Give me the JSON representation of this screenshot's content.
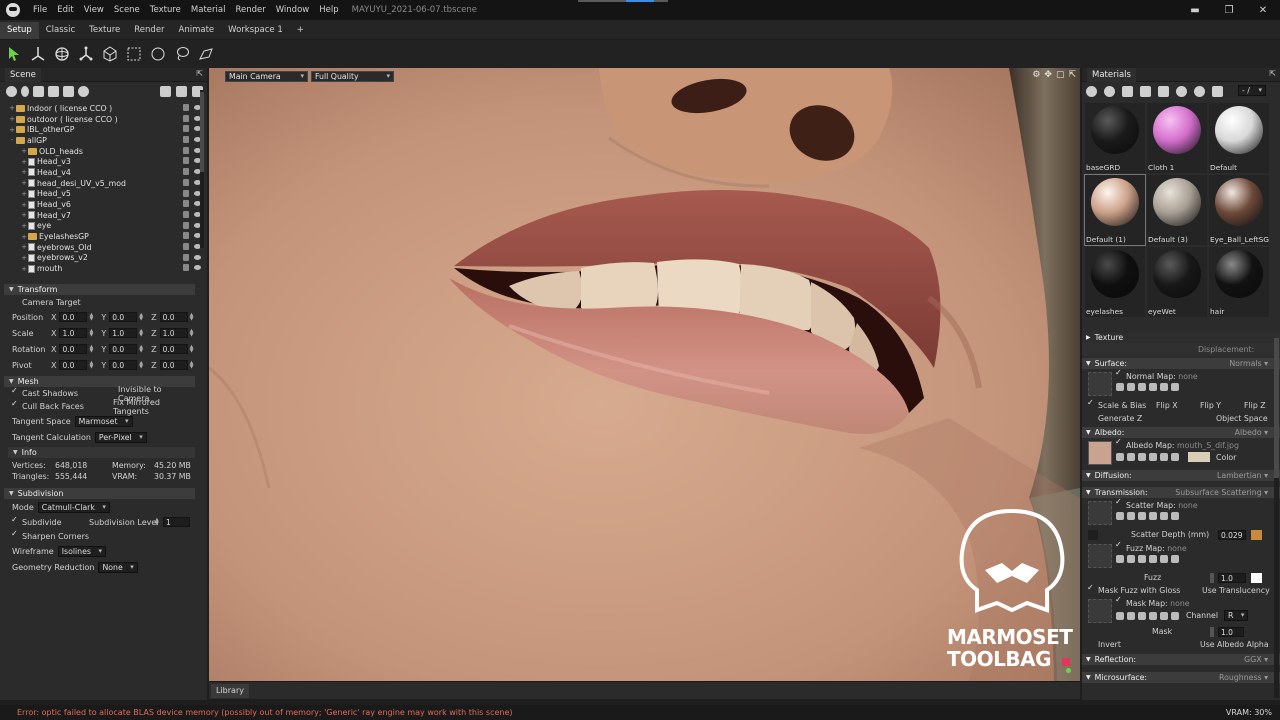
{
  "app": {
    "menu": [
      "File",
      "Edit",
      "View",
      "Scene",
      "Texture",
      "Material",
      "Render",
      "Window",
      "Help"
    ],
    "document_title": "MAYUYU_2021-06-07.tbscene"
  },
  "workspace_tabs": [
    "Setup",
    "Classic",
    "Texture",
    "Render",
    "Animate",
    "Workspace 1",
    "+"
  ],
  "scene": {
    "title": "Scene",
    "tree": [
      {
        "label": "Indoor ( license CCO )",
        "kind": "folder",
        "indent": 0,
        "expand": "+"
      },
      {
        "label": "outdoor ( license CCO )",
        "kind": "folder",
        "indent": 0,
        "expand": "+"
      },
      {
        "label": "IBL_otherGP",
        "kind": "folder",
        "indent": 0,
        "expand": "+"
      },
      {
        "label": "allGP",
        "kind": "folder",
        "indent": 0,
        "expand": "-"
      },
      {
        "label": "OLD_heads",
        "kind": "folder",
        "indent": 1,
        "expand": "+"
      },
      {
        "label": "Head_v3",
        "kind": "mesh",
        "indent": 1,
        "expand": "+"
      },
      {
        "label": "Head_v4",
        "kind": "mesh",
        "indent": 1,
        "expand": "+"
      },
      {
        "label": "head_desi_UV_v5_mod",
        "kind": "mesh",
        "indent": 1,
        "expand": "+"
      },
      {
        "label": "Head_v5",
        "kind": "mesh",
        "indent": 1,
        "expand": "+"
      },
      {
        "label": "Head_v6",
        "kind": "mesh",
        "indent": 1,
        "expand": "+"
      },
      {
        "label": "Head_v7",
        "kind": "mesh",
        "indent": 1,
        "expand": "+"
      },
      {
        "label": "eye",
        "kind": "mesh",
        "indent": 1,
        "expand": "+"
      },
      {
        "label": "EyelashesGP",
        "kind": "folder",
        "indent": 1,
        "expand": "+"
      },
      {
        "label": "eyebrows_Old",
        "kind": "mesh",
        "indent": 1,
        "expand": "+"
      },
      {
        "label": "eyebrows_v2",
        "kind": "mesh",
        "indent": 1,
        "expand": "+"
      },
      {
        "label": "mouth",
        "kind": "mesh",
        "indent": 1,
        "expand": "+"
      }
    ]
  },
  "transform": {
    "title": "Transform",
    "camera_target": "Camera Target",
    "rows": [
      {
        "label": "Position",
        "x": "0.0",
        "y": "0.0",
        "z": "0.0"
      },
      {
        "label": "Scale",
        "x": "1.0",
        "y": "1.0",
        "z": "1.0"
      },
      {
        "label": "Rotation",
        "x": "0.0",
        "y": "0.0",
        "z": "0.0"
      },
      {
        "label": "Pivot",
        "x": "0.0",
        "y": "0.0",
        "z": "0.0"
      }
    ],
    "axis_labels": [
      "X",
      "Y",
      "Z"
    ]
  },
  "mesh": {
    "title": "Mesh",
    "cast_shadows": "Cast Shadows",
    "invisible_to_camera": "Invisible to Camera",
    "cull_back_faces": "Cull Back Faces",
    "fix_mirrored_tangents": "Fix Mirrored Tangents",
    "tangent_space_label": "Tangent Space",
    "tangent_space_value": "Marmoset",
    "tangent_calc_label": "Tangent Calculation",
    "tangent_calc_value": "Per-Pixel",
    "info_title": "Info",
    "vertices_label": "Vertices:",
    "vertices_value": "648,018",
    "triangles_label": "Triangles:",
    "triangles_value": "555,444",
    "memory_label": "Memory:",
    "memory_value": "45.20 MB",
    "vram_label": "VRAM:",
    "vram_value": "30.37 MB"
  },
  "subdivision": {
    "title": "Subdivision",
    "mode_label": "Mode",
    "mode_value": "Catmull-Clark",
    "subdivide": "Subdivide",
    "level_label": "Subdivision Level",
    "level_value": "1",
    "sharpen_corners": "Sharpen Corners",
    "wireframe_label": "Wireframe",
    "wireframe_value": "Isolines",
    "geo_reduction_label": "Geometry Reduction",
    "geo_reduction_value": "None"
  },
  "viewport": {
    "camera": "Main Camera",
    "quality": "Full Quality",
    "logo_line1": "MARMOSET",
    "logo_line2": "TOOLBAG"
  },
  "library": {
    "tab": "Library"
  },
  "materials": {
    "title": "Materials",
    "filter": "- /",
    "items": [
      {
        "name": "baseGRD",
        "color": "#1a1a1a",
        "hl": "#5a5a5a"
      },
      {
        "name": "Cloth 1",
        "color": "#d46fcc",
        "hl": "#f7c2f1"
      },
      {
        "name": "Default",
        "color": "#d8d8d8",
        "hl": "#ffffff"
      },
      {
        "name": "Default (1)",
        "color": "#caa088",
        "hl": "#fff5ee"
      },
      {
        "name": "Default (3)",
        "color": "#a89f94",
        "hl": "#e8e2da"
      },
      {
        "name": "Eye_Ball_LeftSG",
        "color": "#6e4a3a",
        "hl": "#f1e8e1"
      },
      {
        "name": "eyelashes",
        "color": "#0f0f0f",
        "hl": "#4a4a4a"
      },
      {
        "name": "eyeWet",
        "color": "#181818",
        "hl": "#5a5a5a"
      },
      {
        "name": "hair",
        "color": "#121212",
        "hl": "#8a8a8a"
      }
    ],
    "texture": "Texture",
    "displacement": "Displacement:",
    "surface": {
      "label": "Surface:",
      "value": "Normals"
    },
    "normal_map": {
      "label": "Normal Map:",
      "value": "none"
    },
    "scale_bias": "Scale & Bias",
    "flip_x": "Flip X",
    "flip_y": "Flip Y",
    "flip_z": "Flip Z",
    "generate_z": "Generate Z",
    "object_space": "Object Space",
    "albedo": {
      "label": "Albedo:",
      "value": "Albedo"
    },
    "albedo_map": {
      "label": "Albedo Map:",
      "value": "mouth_S_dif.jpg"
    },
    "albedo_color_label": "Color",
    "diffusion": {
      "label": "Diffusion:",
      "value": "Lambertian"
    },
    "transmission": {
      "label": "Transmission:",
      "value": "Subsurface Scattering"
    },
    "scatter_map": {
      "label": "Scatter Map:",
      "value": "none"
    },
    "scatter_depth": {
      "label": "Scatter Depth (mm)",
      "value": "0.029"
    },
    "fuzz_map": {
      "label": "Fuzz Map:",
      "value": "none"
    },
    "fuzz": {
      "label": "Fuzz",
      "value": "1.0"
    },
    "mask_fuzz": "Mask Fuzz with Gloss",
    "use_translucency": "Use Translucency",
    "mask_map": {
      "label": "Mask Map:",
      "value": "none"
    },
    "channel": {
      "label": "Channel",
      "value": "R"
    },
    "mask": {
      "label": "Mask",
      "value": "1.0"
    },
    "invert": "Invert",
    "use_albedo_alpha": "Use Albedo Alpha",
    "reflection": {
      "label": "Reflection:",
      "value": "GGX"
    },
    "microsurface": {
      "label": "Microsurface:",
      "value": "Roughness"
    }
  },
  "colors": {
    "scatter_swatch": "#c98a3c",
    "albedo_swatch": "#d9cfb6",
    "fuzz_swatch": "#ffffff",
    "accent": "#3a8ee6"
  },
  "status": {
    "error": "Error: optic failed to allocate BLAS device memory (possibly out of memory; 'Generic' ray engine may work with this scene)",
    "vram": "VRAM: 30%"
  }
}
